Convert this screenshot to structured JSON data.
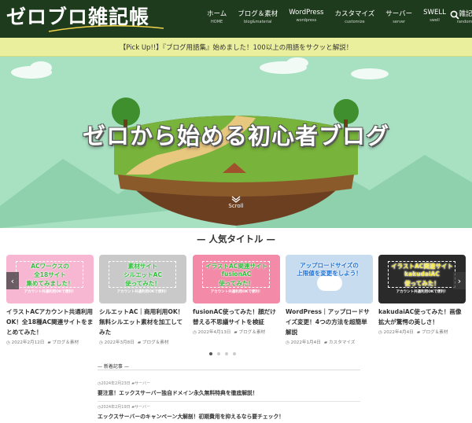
{
  "header": {
    "logo": "ゼロブロ雑記帳",
    "nav": [
      {
        "label": "ホーム",
        "sub": "HOME"
      },
      {
        "label": "ブログ＆素材",
        "sub": "blog&material"
      },
      {
        "label": "WordPress",
        "sub": "wordpress"
      },
      {
        "label": "カスタマイズ",
        "sub": "customize"
      },
      {
        "label": "サーバー",
        "sub": "server"
      },
      {
        "label": "SWELL",
        "sub": "swell"
      },
      {
        "label": "雑記事",
        "sub": "randomnote"
      }
    ]
  },
  "pickup": {
    "text": "【Pick Up!!】『ブログ用語集』始めました！100以上の用語をサクッと解説！"
  },
  "hero": {
    "title": "ゼロから始める初心者ブログ",
    "scroll": "Scroll"
  },
  "section": {
    "title": "— 人気タイトル —"
  },
  "cards": [
    {
      "thumb_lines": [
        "ACワークスの",
        "全18サイト",
        "集めてみました！"
      ],
      "thumb_note": "アカウント共通利用OKで便利！",
      "title": "イラストACアカウント共通利用OK！全18種AC関連サイトをまとめてみた！",
      "date": "2022年2月12日",
      "category": "ブログ＆素材",
      "bg": "#f7b7d2"
    },
    {
      "thumb_lines": [
        "素材サイト",
        "シルエットAC",
        "使ってみた！"
      ],
      "thumb_note": "アカウント共通利用OKで便利！",
      "title": "シルエットAC｜商用利用OK！無料シルエット素材を加工してみた",
      "date": "2022年3月8日",
      "category": "ブログ＆素材",
      "bg": "#c9c9c9"
    },
    {
      "thumb_lines": [
        "イラストAC関連サイト",
        "fusionAC",
        "使ってみた！"
      ],
      "thumb_note": "アカウント共通利用OKで便利！",
      "title": "fusionAC使ってみた！顔だけ替える不思議サイトを検証",
      "date": "2022年4月13日",
      "category": "ブログ＆素材",
      "bg": "#f28aa8"
    },
    {
      "thumb_lines": [
        "アップロードサイズの",
        "上限値を変更をしよう！"
      ],
      "thumb_note": "",
      "title": "WordPress｜アップロードサイズ変更！4つの方法を超簡単解説",
      "date": "2022年1月4日",
      "category": "カスタマイズ",
      "bg": "#c7dcef"
    },
    {
      "thumb_lines": [
        "イラストAC関連サイト",
        "kakudaiAC",
        "使ってみた！"
      ],
      "thumb_note": "アカウント共通利用OKで便利！",
      "title": "kakudaiAC使ってみた！画像拡大が驚愕の美しさ！",
      "date": "2022年4月4日",
      "category": "ブログ＆素材",
      "bg": "#2a2a2a"
    }
  ],
  "slider": {
    "prev": "‹",
    "next": "›",
    "dots": 4,
    "active": 0
  },
  "latest": {
    "label": "— 新着記事 —",
    "items": [
      {
        "date": "2024年2月23日",
        "category": "サーバー",
        "title": "要注意！エックスサーバー独自ドメイン永久無料特典を徹底解説！"
      },
      {
        "date": "2024年2月19日",
        "category": "サーバー",
        "title": "エックスサーバーのキャンペーン大解剖！初期費用を抑えるなら要チェック！"
      }
    ]
  },
  "colors": {
    "header": "#1f3b1d",
    "pickup": "#e9ef9c",
    "hero": "#a8e0c2",
    "accent_green": "#2fbf3a"
  },
  "icons": [
    "search-icon",
    "chevron-left-icon",
    "chevron-right-icon",
    "chevron-down-icon",
    "clock-icon",
    "folder-icon"
  ]
}
